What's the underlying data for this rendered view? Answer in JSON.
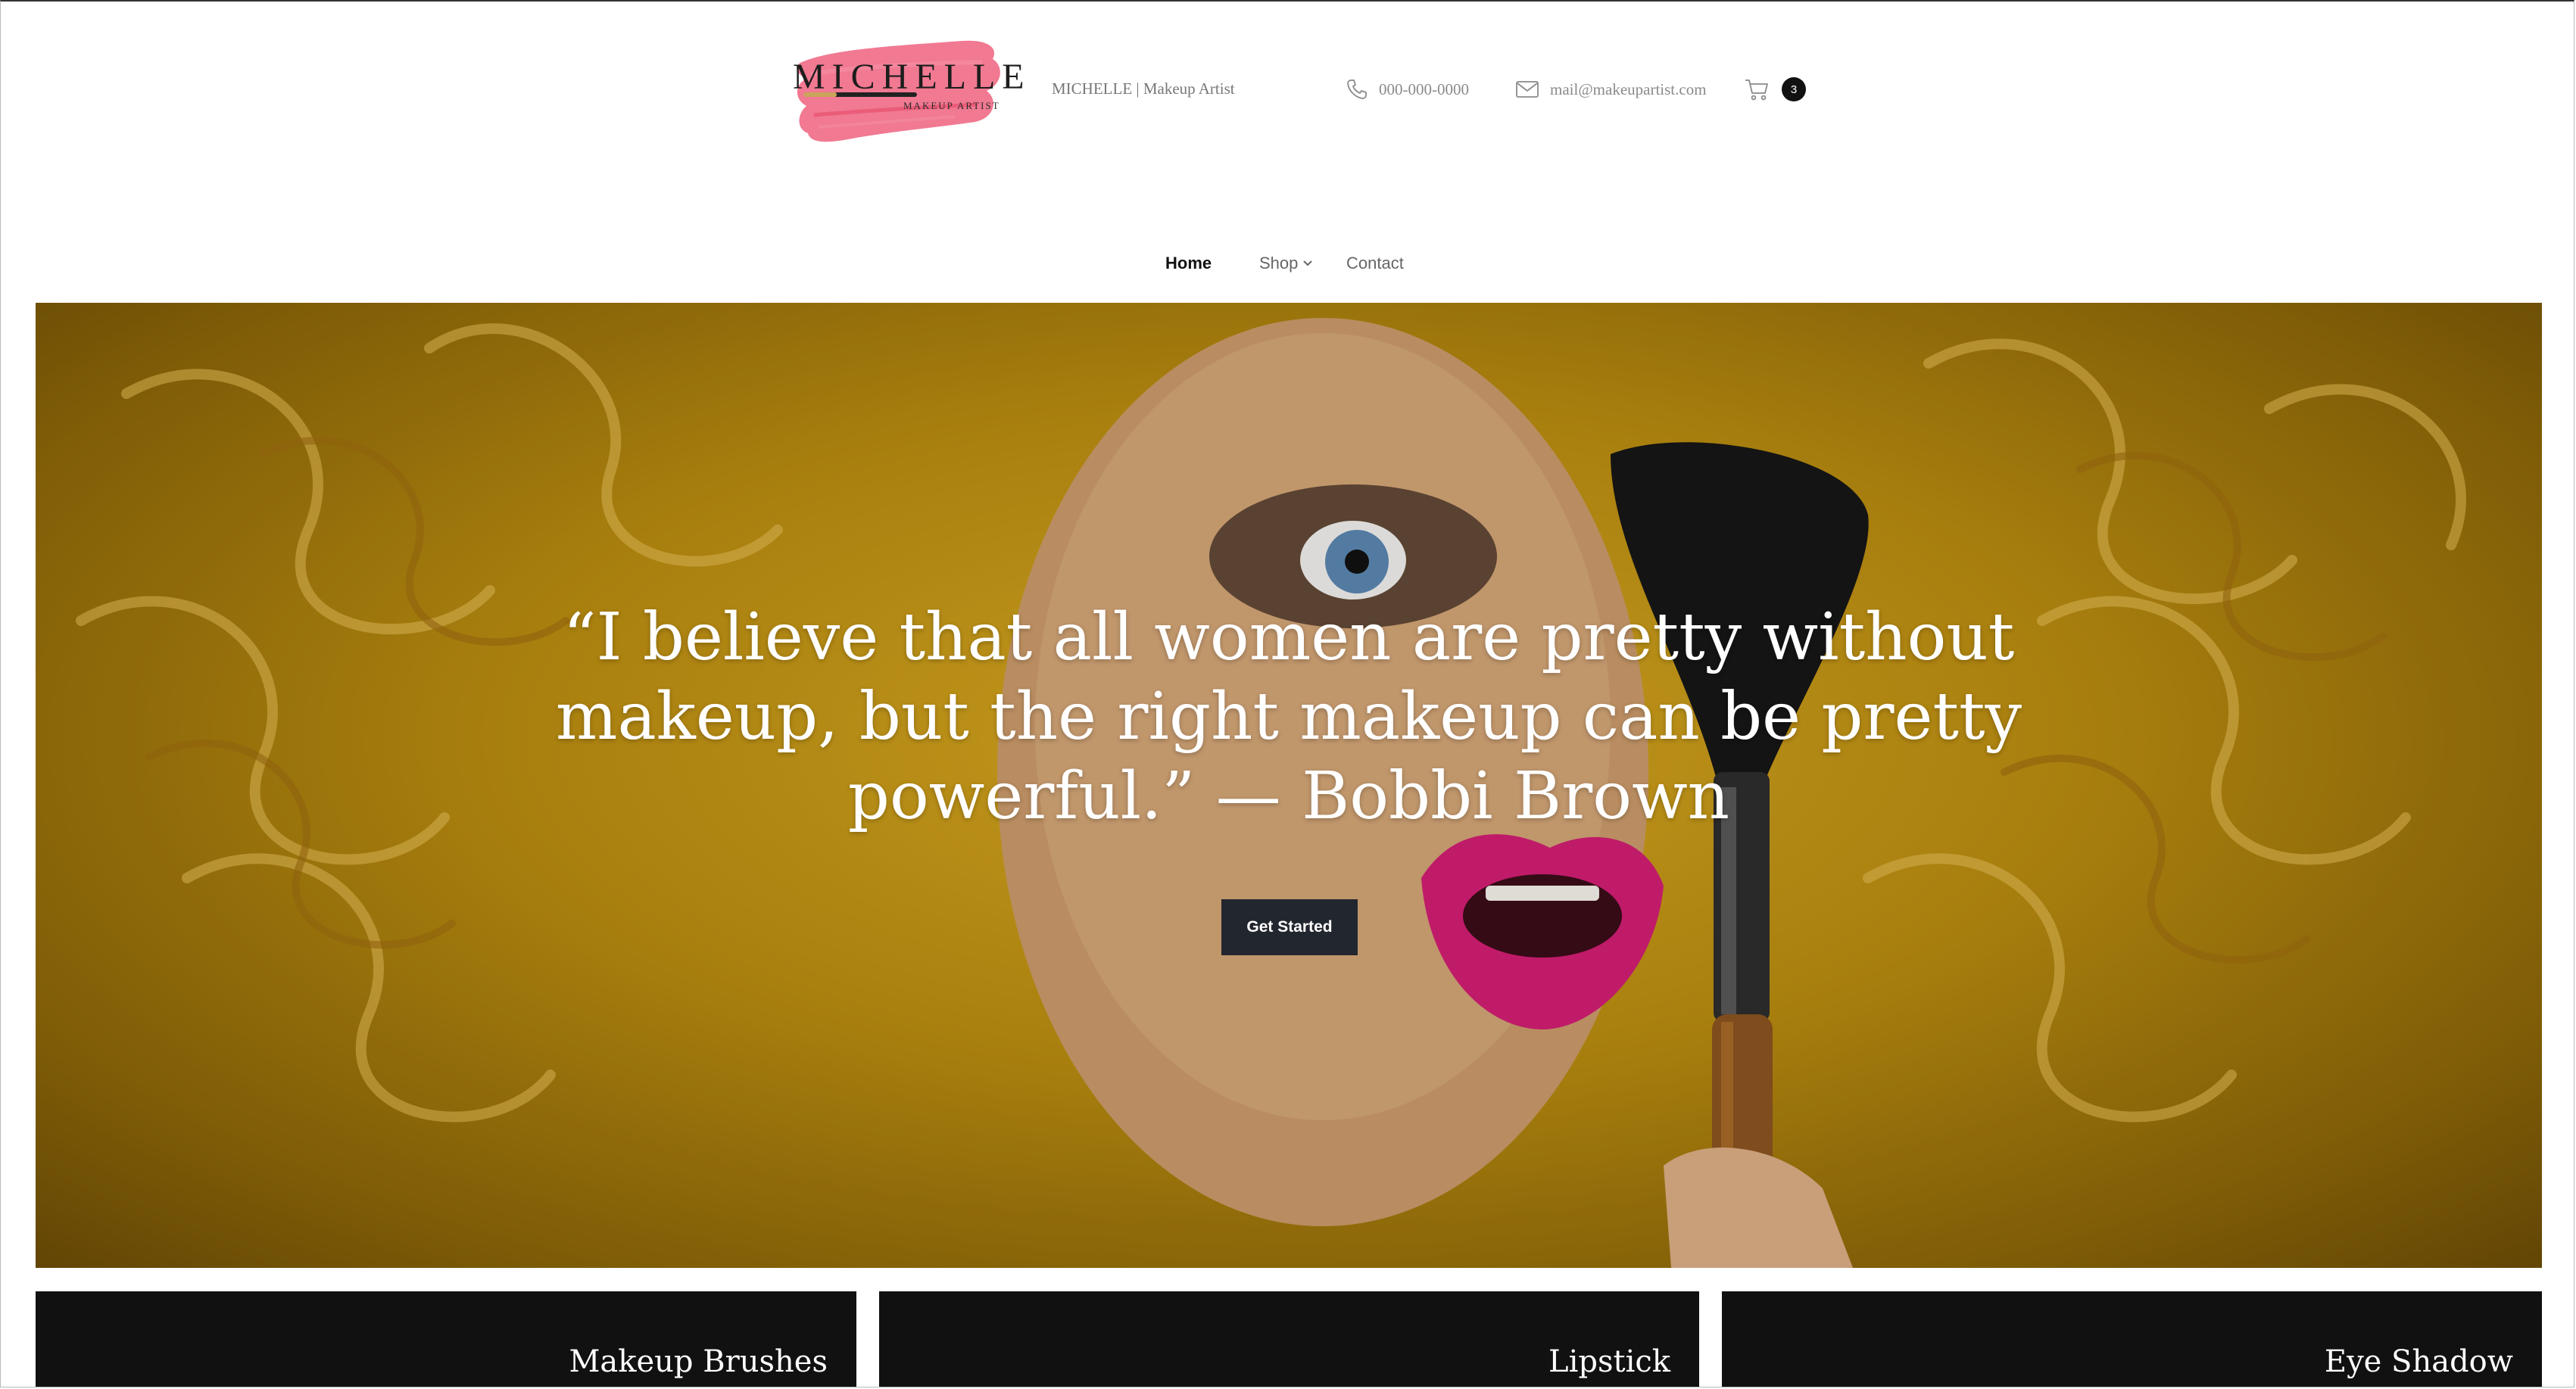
{
  "header": {
    "logo": {
      "title": "MICHELLE",
      "subtitle": "MAKEUP ARTIST"
    },
    "tagline": "MICHELLE | Makeup Artist",
    "contact": {
      "phone_icon": "phone-icon",
      "phone": "000-000-0000",
      "email_icon": "mail-icon",
      "email": "mail@makeupartist.com"
    },
    "cart": {
      "icon": "cart-icon",
      "count": "3"
    }
  },
  "nav": {
    "items": [
      {
        "label": "Home",
        "active": true
      },
      {
        "label": "Shop",
        "has_dropdown": true,
        "dropdown_icon": "chevron-down-icon"
      },
      {
        "label": "Contact"
      }
    ]
  },
  "hero": {
    "quote": "“I believe that all women are pretty without makeup, but the right makeup can be pretty powerful.” — Bobbi Brown",
    "button_label": "Get Started",
    "background_colors": [
      "#d6a822",
      "#b78a10",
      "#6b4c06"
    ]
  },
  "categories": [
    {
      "title": "Makeup Brushes"
    },
    {
      "title": "Lipstick"
    },
    {
      "title": "Eye Shadow"
    }
  ],
  "colors": {
    "logo_brush": "#f06a86",
    "card_background": "#111111",
    "button_background": "#22262e",
    "lip": "#d01e72"
  }
}
